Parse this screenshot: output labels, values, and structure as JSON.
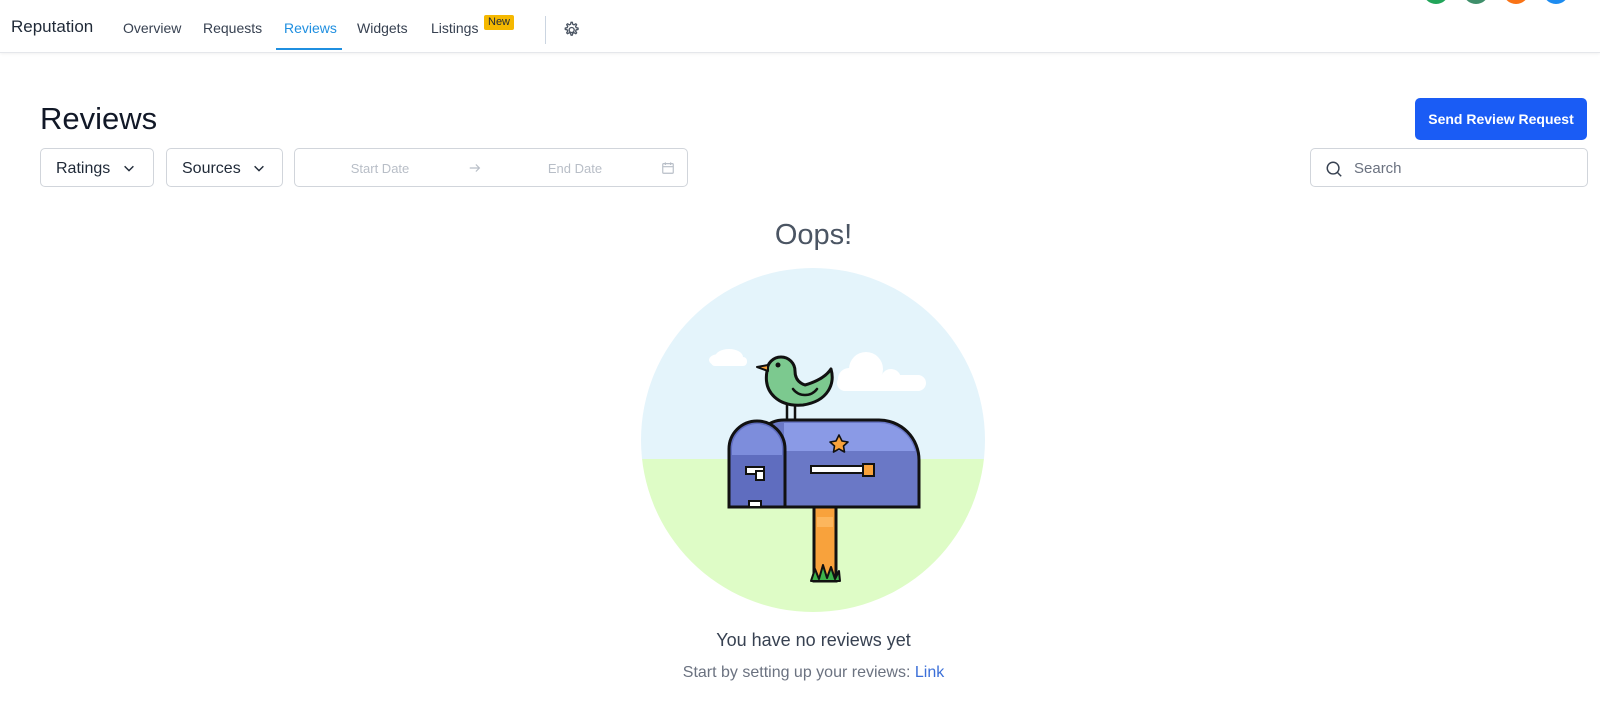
{
  "nav": {
    "brand": "Reputation",
    "tabs": [
      {
        "label": "Overview"
      },
      {
        "label": "Requests"
      },
      {
        "label": "Reviews",
        "active": true
      },
      {
        "label": "Widgets"
      },
      {
        "label": "Listings",
        "badge": "New"
      }
    ],
    "settings_icon": "gear-icon",
    "accent_color": "#1f8fe0",
    "badge_color": "#f5b800"
  },
  "avatars": [
    {
      "color": "#22a55a"
    },
    {
      "color": "#3f8f6b"
    },
    {
      "color": "#f97316"
    },
    {
      "color": "#1d8cf0"
    }
  ],
  "page": {
    "title": "Reviews",
    "primary_button": "Send Review Request",
    "primary_color": "#1a5cf5"
  },
  "filters": {
    "ratings_label": "Ratings",
    "sources_label": "Sources",
    "start_date_placeholder": "Start Date",
    "end_date_placeholder": "End Date",
    "search_placeholder": "Search"
  },
  "empty_state": {
    "heading": "Oops!",
    "message": "You have no reviews yet",
    "sub_text": "Start by setting up your reviews: ",
    "link_text": "Link",
    "illustration": "mailbox-with-bird"
  }
}
